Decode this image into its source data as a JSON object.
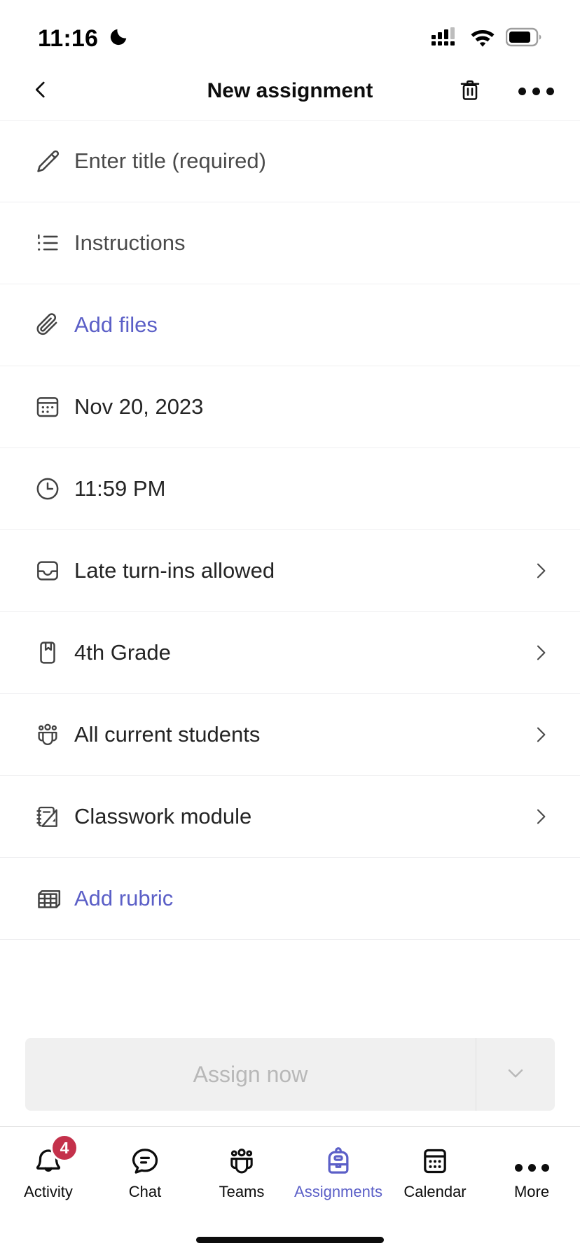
{
  "status_bar": {
    "time": "11:16",
    "moon_icon": "crescent-moon-icon",
    "signal_icon": "cellular-signal-icon",
    "wifi_icon": "wifi-icon",
    "battery_icon": "battery-icon"
  },
  "header": {
    "back_icon": "chevron-left-icon",
    "title": "New assignment",
    "delete_icon": "trash-icon",
    "more_icon": "more-horizontal-icon"
  },
  "form_rows": [
    {
      "icon": "pencil-icon",
      "label": "Enter title (required)",
      "style": "placeholder",
      "chevron": false,
      "name": "title-field"
    },
    {
      "icon": "list-icon",
      "label": "Instructions",
      "style": "placeholder",
      "chevron": false,
      "name": "instructions-field"
    },
    {
      "icon": "paperclip-icon",
      "label": "Add files",
      "style": "link",
      "chevron": false,
      "name": "add-files-row"
    },
    {
      "icon": "calendar-icon",
      "label": "Nov 20, 2023",
      "style": "value",
      "chevron": false,
      "name": "due-date-row"
    },
    {
      "icon": "clock-icon",
      "label": "11:59 PM",
      "style": "value",
      "chevron": false,
      "name": "due-time-row"
    },
    {
      "icon": "inbox-icon",
      "label": "Late turn-ins allowed",
      "style": "value",
      "chevron": true,
      "name": "late-turnins-row"
    },
    {
      "icon": "book-icon",
      "label": "4th Grade",
      "style": "value",
      "chevron": true,
      "name": "class-row"
    },
    {
      "icon": "people-icon",
      "label": "All current students",
      "style": "value",
      "chevron": true,
      "name": "assign-to-row"
    },
    {
      "icon": "classwork-icon",
      "label": "Classwork module",
      "style": "value",
      "chevron": true,
      "name": "classwork-module-row"
    },
    {
      "icon": "grid-icon",
      "label": "Add rubric",
      "style": "link",
      "chevron": false,
      "name": "add-rubric-row"
    }
  ],
  "assign_bar": {
    "primary_label": "Assign now",
    "caret_icon": "chevron-down-icon",
    "disabled": true
  },
  "tabs": [
    {
      "icon": "bell-icon",
      "label": "Activity",
      "badge": "4",
      "active": false,
      "name": "tab-activity"
    },
    {
      "icon": "chat-icon",
      "label": "Chat",
      "badge": "",
      "active": false,
      "name": "tab-chat"
    },
    {
      "icon": "people-icon",
      "label": "Teams",
      "badge": "",
      "active": false,
      "name": "tab-teams"
    },
    {
      "icon": "backpack-icon",
      "label": "Assignments",
      "badge": "",
      "active": true,
      "name": "tab-assignments"
    },
    {
      "icon": "calendar-icon",
      "label": "Calendar",
      "badge": "",
      "active": false,
      "name": "tab-calendar"
    },
    {
      "icon": "more-horizontal-icon",
      "label": "More",
      "badge": "",
      "active": false,
      "name": "tab-more"
    }
  ],
  "colors": {
    "accent": "#5b5fc7",
    "badge": "#c4314b",
    "text": "#242424",
    "muted": "#b8b8b8",
    "divider": "#efeff1"
  }
}
